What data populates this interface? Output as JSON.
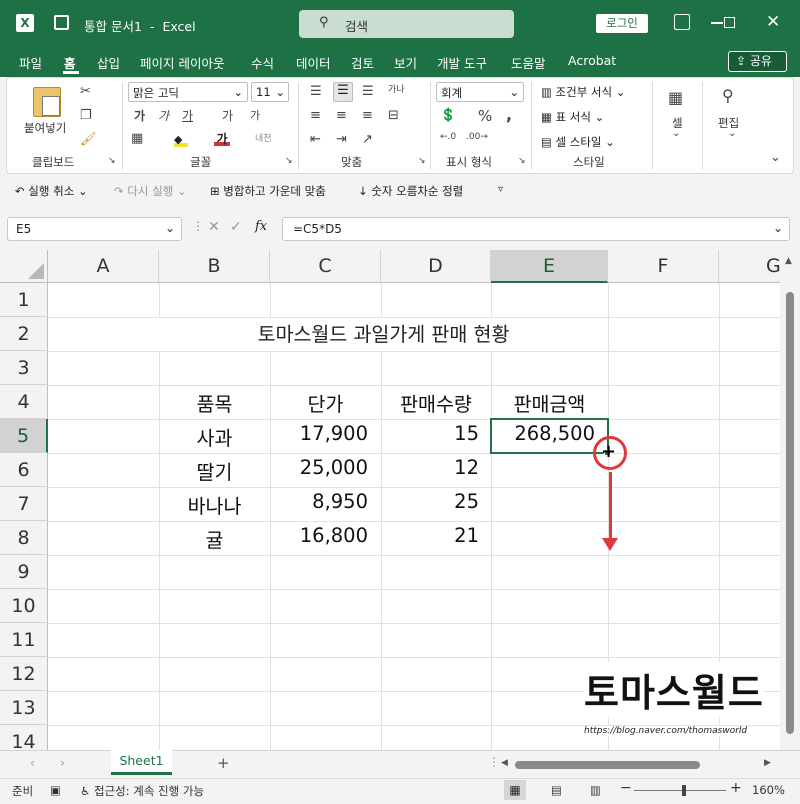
{
  "app": {
    "doc_title": "통합 문서1",
    "app_name": "Excel",
    "search_placeholder": "검색",
    "login": "로그인"
  },
  "menu": [
    "파일",
    "홈",
    "삽입",
    "페이지 레이아웃",
    "수식",
    "데이터",
    "검토",
    "보기",
    "개발 도구",
    "도움말",
    "Acrobat"
  ],
  "share": "공유",
  "ribbon": {
    "paste": "붙여넣기",
    "clipboard": "클립보드",
    "font_name": "맑은 고딕",
    "font_size": "11",
    "font_group": "글꼴",
    "align_group": "맞춤",
    "number_format": "회계",
    "number_group": "표시 형식",
    "cond_format": "조건부 서식",
    "table_format": "표 서식",
    "cell_style": "셀 스타일",
    "style_group": "스타일",
    "cells": "셀",
    "editing": "편집",
    "wrap_text": "자동 줄 바꿈",
    "bold": "가",
    "italic": "가",
    "underline": "가",
    "grow": "가",
    "shrink": "가"
  },
  "qat": {
    "undo": "실행 취소",
    "redo": "다시 실행",
    "merge": "병합하고 가운데 맞춤",
    "sort": "숫자 오름차순 정렬"
  },
  "formula_bar": {
    "name_box": "E5",
    "formula": "=C5*D5",
    "fx": "fx"
  },
  "columns": [
    "A",
    "B",
    "C",
    "D",
    "E",
    "F",
    "G"
  ],
  "rows": [
    "1",
    "2",
    "3",
    "4",
    "5",
    "6",
    "7",
    "8",
    "9",
    "10",
    "11",
    "12",
    "13",
    "14"
  ],
  "sheet": {
    "title": "토마스월드 과일가게 판매 현황",
    "headers": [
      "품목",
      "단가",
      "판매수량",
      "판매금액"
    ],
    "data": [
      {
        "item": "사과",
        "price": "17,900",
        "qty": "15",
        "total": "268,500"
      },
      {
        "item": "딸기",
        "price": "25,000",
        "qty": "12",
        "total": ""
      },
      {
        "item": "바나나",
        "price": "8,950",
        "qty": "25",
        "total": ""
      },
      {
        "item": "귤",
        "price": "16,800",
        "qty": "21",
        "total": ""
      }
    ]
  },
  "watermark": {
    "text": "토마스월드",
    "url": "https://blog.naver.com/thomasworld"
  },
  "tabs": {
    "sheet1": "Sheet1",
    "add": "+"
  },
  "status": {
    "ready": "준비",
    "accessibility": "접근성: 계속 진행 가능",
    "zoom": "160%"
  },
  "colors": {
    "excel_green": "#1e7145",
    "accent_red": "#e0383a",
    "selection": "#217346"
  }
}
